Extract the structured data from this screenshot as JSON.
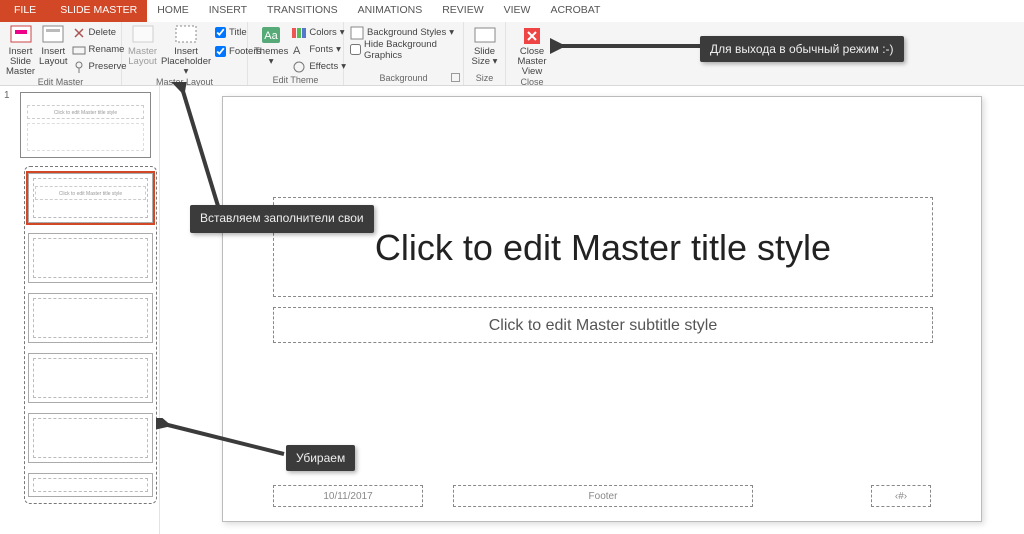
{
  "tabs": {
    "file": "FILE",
    "items": [
      "SLIDE MASTER",
      "HOME",
      "INSERT",
      "TRANSITIONS",
      "ANIMATIONS",
      "REVIEW",
      "VIEW",
      "ACROBAT"
    ],
    "active": "SLIDE MASTER"
  },
  "ribbon": {
    "editMaster": {
      "insertSlideMaster": "Insert Slide Master",
      "insertLayout": "Insert Layout",
      "delete": "Delete",
      "rename": "Rename",
      "preserve": "Preserve",
      "label": "Edit Master"
    },
    "masterLayout": {
      "masterLayout": "Master Layout",
      "insertPlaceholder": "Insert Placeholder",
      "title": "Title",
      "footers": "Footers",
      "label": "Master Layout"
    },
    "editTheme": {
      "themes": "Themes",
      "colors": "Colors",
      "fonts": "Fonts",
      "effects": "Effects",
      "label": "Edit Theme"
    },
    "background": {
      "styles": "Background Styles",
      "hide": "Hide Background Graphics",
      "label": "Background"
    },
    "size": {
      "slideSize": "Slide Size",
      "label": "Size"
    },
    "close": {
      "closeMaster": "Close Master View",
      "label": "Close"
    }
  },
  "thumbs": {
    "number": "1",
    "miniTitle": "Click to edit Master title style"
  },
  "slide": {
    "title": "Click to edit Master title style",
    "subtitle": "Click to edit Master subtitle style",
    "date": "10/11/2017",
    "footer": "Footer",
    "num": "‹#›"
  },
  "callouts": {
    "close": "Для выхода в обычный режим :-)",
    "insert": "Вставляем заполнители свои",
    "remove": "Убираем"
  }
}
